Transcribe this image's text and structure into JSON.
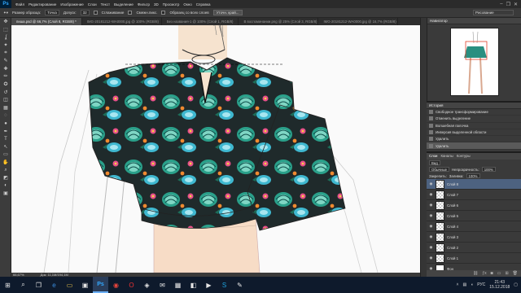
{
  "app": {
    "logo": "Ps"
  },
  "menu": [
    "Файл",
    "Редактирование",
    "Изображение",
    "Слои",
    "Текст",
    "Выделение",
    "Фильтр",
    "3D",
    "Просмотр",
    "Окно",
    "Справка"
  ],
  "window_controls": [
    "–",
    "❐",
    "✕"
  ],
  "options": {
    "sample_size_label": "Размер образца:",
    "sample_size_value": "Точка",
    "tolerance_label": "Допуск:",
    "tolerance_value": "32",
    "antialias_label": "Сглаживание",
    "contiguous_label": "Смежн.пикс.",
    "all_layers_label": "Образец со всех слоев",
    "refine_button": "Уточн. край...",
    "workspace": "Рисование"
  },
  "tabs": [
    {
      "label": "пиша.psd @ 66,7% (Слой 8, RGB/8) *",
      "active": true
    },
    {
      "label": "IMG-20181212-WA0000.jpg @ 100% (RGB/8)",
      "active": false
    },
    {
      "label": "Без названия-1 @ 100% (Слой 1, RGB/8)",
      "active": false
    },
    {
      "label": "В воспоминании.png @ 25% (Слой 3, RGB/8)",
      "active": false
    },
    {
      "label": "IMG-20181212-WA0000.jpg @ 16,7% (RGB/8)",
      "active": false
    }
  ],
  "tools": [
    "move-icon",
    "marquee-icon",
    "lasso-icon",
    "magic-wand-icon",
    "crop-icon",
    "eyedropper-icon",
    "healing-icon",
    "brush-icon",
    "clone-stamp-icon",
    "history-brush-icon",
    "eraser-icon",
    "gradient-icon",
    "blur-icon",
    "dodge-icon",
    "pen-icon",
    "type-icon",
    "path-selection-icon",
    "shape-icon",
    "hand-icon",
    "zoom-icon",
    "colors-icon",
    "quickmask-icon",
    "screenmode-icon"
  ],
  "tool_glyphs": [
    "✥",
    "⬚",
    "ʆ",
    "✦",
    "⌗",
    "✎",
    "✚",
    "✏",
    "✪",
    "↺",
    "◫",
    "▦",
    "◌",
    "●",
    "✒",
    "T",
    "↖",
    "▭",
    "✋",
    "⌕",
    "◩",
    "◐",
    "▣"
  ],
  "status": {
    "zoom": "66,67%",
    "doc": "Док: 11,1М/194,1М"
  },
  "panels": {
    "navigator_tab": "Навигатор",
    "history_tab": "История",
    "history_items": [
      "Свободное трансформирование",
      "Отменить выделение",
      "Волшебная палочка",
      "Инверсия выделенной области",
      "Удалить",
      "Удалить"
    ],
    "layers_tabs": [
      "Слои",
      "Каналы",
      "Контуры"
    ],
    "kind_label": "Вид",
    "blend_mode": "Обычные",
    "opacity_label": "Непрозрачность:",
    "opacity_value": "100%",
    "lock_label": "Закрепить:",
    "fill_label": "Заливка:",
    "fill_value": "100%",
    "layers": [
      {
        "name": "Слой 8",
        "active": true
      },
      {
        "name": "Слой 7",
        "active": false
      },
      {
        "name": "Слой 6",
        "active": false
      },
      {
        "name": "Слой 5",
        "active": false
      },
      {
        "name": "Слой 4",
        "active": false
      },
      {
        "name": "Слой 3",
        "active": false
      },
      {
        "name": "Слой 2",
        "active": false
      },
      {
        "name": "Слой 1",
        "active": false
      },
      {
        "name": "Фон",
        "active": false
      }
    ]
  },
  "taskbar": {
    "language": "РУС",
    "time": "21:43",
    "date": "15.12.2018"
  }
}
